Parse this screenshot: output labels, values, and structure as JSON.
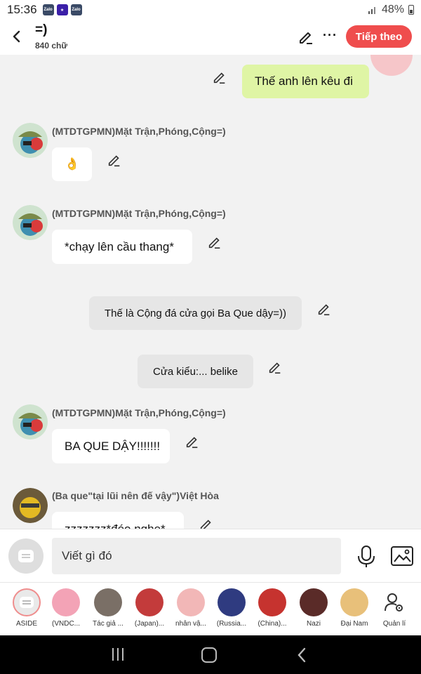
{
  "status": {
    "time": "15:36",
    "app_icons": [
      "zalo-icon",
      "star-app-icon",
      "zalo-icon"
    ],
    "battery": "48%"
  },
  "header": {
    "title": "=)",
    "subtitle": "840 chữ",
    "follow_label": "Tiếp theo",
    "more_label": "···"
  },
  "messages": [
    {
      "type": "mine",
      "text": "Thế anh lên kêu đi"
    },
    {
      "type": "char",
      "sender": "(MTDTGPMN)Mặt Trận,Phóng,Cộng=)",
      "text": "👌"
    },
    {
      "type": "char",
      "sender": "(MTDTGPMN)Mặt Trận,Phóng,Cộng=)",
      "text": "*chạy lên cầu thang*"
    },
    {
      "type": "narration",
      "text": "Thế là Cộng đá cửa gọi Ba Que dậy=))"
    },
    {
      "type": "narration",
      "text": "Cửa kiểu:... belike"
    },
    {
      "type": "char",
      "sender": "(MTDTGPMN)Mặt Trận,Phóng,Cộng=)",
      "text": "BA QUE DẬY!!!!!!!"
    },
    {
      "type": "char",
      "sender": "(Ba que\"tại lũi nên đế vậy\")Việt Hòa",
      "text": "zzzzzzz*đéo nghe*"
    }
  ],
  "composer": {
    "placeholder": "Viết gì đó"
  },
  "characters": [
    {
      "label": "ASIDE",
      "color": "#e9e9e9"
    },
    {
      "label": "(VNDC...",
      "color": "#f3a3b6"
    },
    {
      "label": "Tác giả ...",
      "color": "#7a6f66"
    },
    {
      "label": "(Japan)...",
      "color": "#c33b3b"
    },
    {
      "label": "nhân vậ...",
      "color": "#f2b7b7"
    },
    {
      "label": "(Russia...",
      "color": "#2f3b80"
    },
    {
      "label": "(China)...",
      "color": "#c6332f"
    },
    {
      "label": "Nazi",
      "color": "#5a2b28"
    },
    {
      "label": "Đại Nam",
      "color": "#e8c07a"
    },
    {
      "label": "Quản lí",
      "color": "#ffffff"
    }
  ],
  "colors": {
    "accent": "#ef4d4d",
    "mine_bubble": "#dff5a5",
    "narration_bubble": "#e6e6e6"
  }
}
